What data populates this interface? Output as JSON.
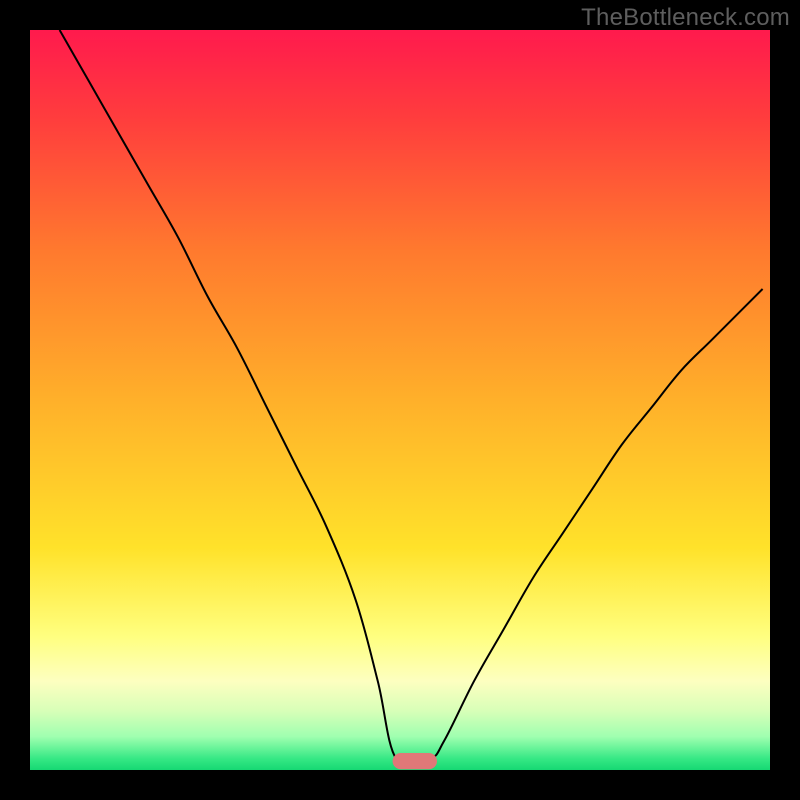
{
  "watermark": "TheBottleneck.com",
  "chart_data": {
    "type": "line",
    "title": "",
    "xlabel": "",
    "ylabel": "",
    "xlim": [
      0,
      100
    ],
    "ylim": [
      0,
      100
    ],
    "background_gradient": {
      "stops": [
        {
          "offset": 0.0,
          "color": "#ff1a4d"
        },
        {
          "offset": 0.12,
          "color": "#ff3d3d"
        },
        {
          "offset": 0.3,
          "color": "#ff7a2e"
        },
        {
          "offset": 0.5,
          "color": "#ffb02a"
        },
        {
          "offset": 0.7,
          "color": "#ffe22a"
        },
        {
          "offset": 0.82,
          "color": "#ffff80"
        },
        {
          "offset": 0.88,
          "color": "#fdffc0"
        },
        {
          "offset": 0.92,
          "color": "#d8ffb8"
        },
        {
          "offset": 0.955,
          "color": "#9fffb0"
        },
        {
          "offset": 0.985,
          "color": "#35e884"
        },
        {
          "offset": 1.0,
          "color": "#16d873"
        }
      ]
    },
    "series": [
      {
        "name": "bottleneck-curve",
        "color": "#000000",
        "x": [
          4,
          8,
          12,
          16,
          20,
          24,
          28,
          32,
          36,
          40,
          44,
          47,
          49.5,
          54,
          56,
          60,
          64,
          68,
          72,
          76,
          80,
          84,
          88,
          92,
          96,
          99
        ],
        "values": [
          100,
          93,
          86,
          79,
          72,
          64,
          57,
          49,
          41,
          33,
          23,
          12,
          1.5,
          1.5,
          4,
          12,
          19,
          26,
          32,
          38,
          44,
          49,
          54,
          58,
          62,
          65
        ]
      }
    ],
    "marker": {
      "name": "target-marker",
      "color": "#e07878",
      "x_center": 52,
      "y": 1.2,
      "width": 6,
      "height": 2.2,
      "corner_radius": 1.1
    }
  }
}
